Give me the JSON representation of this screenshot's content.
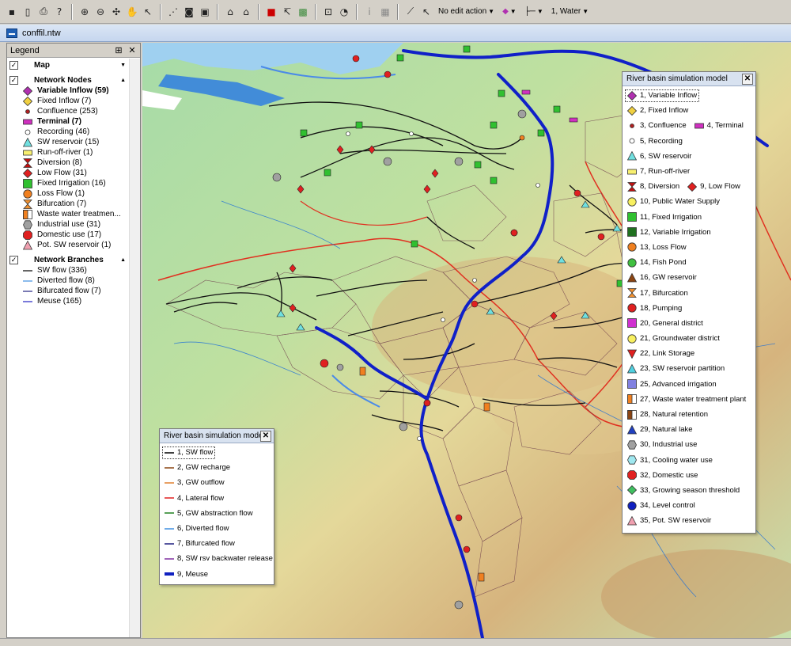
{
  "toolbar": {
    "edit_action": "No edit action",
    "layer": "1, Water",
    "buttons": [
      "save-icon",
      "new-icon",
      "print-icon",
      "help-icon",
      "zoom-in-icon",
      "zoom-out-icon",
      "zoom-extent-icon",
      "pan-icon",
      "select-icon",
      "node-tool-icon",
      "zoom-window-icon",
      "zoom-full-icon",
      "lock-icon",
      "unlock-icon",
      "flag-icon",
      "edit-node-icon",
      "map-icon",
      "screen-icon",
      "layers-icon",
      "info-icon",
      "window-icon",
      "branch-tool-icon",
      "pointer-icon"
    ]
  },
  "document": {
    "title": "conffil.ntw"
  },
  "legend": {
    "title": "Legend",
    "groups": [
      {
        "label": "Map",
        "checked": true,
        "items": []
      },
      {
        "label": "Network Nodes",
        "checked": true,
        "items": [
          {
            "label": "Variable Inflow (59)",
            "symbol": "diamond",
            "color": "#b030b0",
            "bold": true
          },
          {
            "label": "Fixed Inflow (7)",
            "symbol": "diamond",
            "color": "#f0d040"
          },
          {
            "label": "Confluence (253)",
            "symbol": "dot",
            "color": "#b02020"
          },
          {
            "label": "Terminal (7)",
            "symbol": "rect",
            "color": "#d030c0",
            "bold": true
          },
          {
            "label": "Recording (46)",
            "symbol": "circle-open",
            "color": "#ffffff"
          },
          {
            "label": "SW reservoir (15)",
            "symbol": "triangle",
            "color": "#70e0e0"
          },
          {
            "label": "Run-off-river (1)",
            "symbol": "rect",
            "color": "#f8f070"
          },
          {
            "label": "Diversion (8)",
            "symbol": "hourglass",
            "color": "#c01010"
          },
          {
            "label": "Low Flow (31)",
            "symbol": "diamond",
            "color": "#e02020"
          },
          {
            "label": "Fixed Irrigation (16)",
            "symbol": "square",
            "color": "#30c030"
          },
          {
            "label": "Loss Flow (1)",
            "symbol": "circle",
            "color": "#f08020"
          },
          {
            "label": "Bifurcation (7)",
            "symbol": "hourglass",
            "color": "#f09030"
          },
          {
            "label": "Waste water treatmen...",
            "symbol": "square-split",
            "color": "#f08020"
          },
          {
            "label": "Industrial use (31)",
            "symbol": "hexagon",
            "color": "#a0a0a0"
          },
          {
            "label": "Domestic use (17)",
            "symbol": "octagon",
            "color": "#e02020"
          },
          {
            "label": "Pot. SW reservoir (1)",
            "symbol": "triangle",
            "color": "#f0a0b0"
          }
        ]
      },
      {
        "label": "Network Branches",
        "checked": true,
        "items": [
          {
            "label": "SW flow (336)",
            "symbol": "line",
            "color": "#000000"
          },
          {
            "label": "Diverted flow (8)",
            "symbol": "line",
            "color": "#4090e0"
          },
          {
            "label": "Bifurcated flow (7)",
            "symbol": "line",
            "color": "#202080"
          },
          {
            "label": "Meuse (165)",
            "symbol": "line",
            "color": "#2020c0"
          }
        ]
      }
    ]
  },
  "branch_window": {
    "title": "River basin simulation mode",
    "items": [
      {
        "label": "1, SW flow",
        "color": "#000000",
        "width": 1.5,
        "selected": true
      },
      {
        "label": "2, GW recharge",
        "color": "#8b4513",
        "width": 1.5
      },
      {
        "label": "3, GW outflow",
        "color": "#e08030",
        "width": 1.5
      },
      {
        "label": "4, Lateral flow",
        "color": "#e02020",
        "width": 1.5
      },
      {
        "label": "5, GW abstraction flow",
        "color": "#208020",
        "width": 1.5
      },
      {
        "label": "6, Diverted flow",
        "color": "#4090e0",
        "width": 1.5
      },
      {
        "label": "7, Bifurcated flow",
        "color": "#202080",
        "width": 1.5
      },
      {
        "label": "8, SW rsv backwater release",
        "color": "#8030a0",
        "width": 1.5
      },
      {
        "label": "9, Meuse",
        "color": "#1020c0",
        "width": 4
      }
    ]
  },
  "nodes_window": {
    "title": "River basin simulation model",
    "rows": [
      [
        {
          "label": "1, Variable Inflow",
          "symbol": "diamond",
          "color": "#b030b0",
          "selected": true
        }
      ],
      [
        {
          "label": "2, Fixed Inflow",
          "symbol": "diamond",
          "color": "#f0d040"
        }
      ],
      [
        {
          "label": "3, Confluence",
          "symbol": "dot",
          "color": "#b02020"
        },
        {
          "label": "4, Terminal",
          "symbol": "rect",
          "color": "#d030c0"
        }
      ],
      [
        {
          "label": "5, Recording",
          "symbol": "circle-open",
          "color": "#ffffff"
        }
      ],
      [
        {
          "label": "6, SW reservoir",
          "symbol": "triangle",
          "color": "#70e0e0"
        }
      ],
      [
        {
          "label": "7, Run-off-river",
          "symbol": "rect",
          "color": "#f8f070"
        }
      ],
      [
        {
          "label": "8, Diversion",
          "symbol": "hourglass",
          "color": "#c01010"
        },
        {
          "label": "9, Low Flow",
          "symbol": "diamond",
          "color": "#e02020"
        }
      ],
      [
        {
          "label": "10, Public Water Supply",
          "symbol": "circle",
          "color": "#f8f060"
        }
      ],
      [
        {
          "label": "11, Fixed Irrigation",
          "symbol": "square",
          "color": "#30c030"
        }
      ],
      [
        {
          "label": "12, Variable Irrigation",
          "symbol": "square",
          "color": "#207020"
        }
      ],
      [
        {
          "label": "13, Loss Flow",
          "symbol": "circle",
          "color": "#f08020"
        }
      ],
      [
        {
          "label": "14, Fish Pond",
          "symbol": "circle",
          "color": "#40c040"
        }
      ],
      [
        {
          "label": "16, GW reservoir",
          "symbol": "triangle",
          "color": "#8b4513"
        }
      ],
      [
        {
          "label": "17, Bifurcation",
          "symbol": "hourglass",
          "color": "#f09030"
        }
      ],
      [
        {
          "label": "18, Pumping",
          "symbol": "circle",
          "color": "#e02020"
        }
      ],
      [
        {
          "label": "20, General district",
          "symbol": "square",
          "color": "#d030d0"
        }
      ],
      [
        {
          "label": "21, Groundwater district",
          "symbol": "circle",
          "color": "#f8f060"
        }
      ],
      [
        {
          "label": "22, Link Storage",
          "symbol": "triangle-down",
          "color": "#e02020"
        }
      ],
      [
        {
          "label": "23, SW reservoir partition",
          "symbol": "triangle",
          "color": "#50d0e0"
        }
      ],
      [
        {
          "label": "25, Advanced irrigation",
          "symbol": "square",
          "color": "#8080e0"
        }
      ],
      [
        {
          "label": "27, Waste water treatment plant",
          "symbol": "square-split",
          "color": "#f08020"
        }
      ],
      [
        {
          "label": "28, Natural retention",
          "symbol": "square-split",
          "color": "#8b4513"
        }
      ],
      [
        {
          "label": "29, Natural lake",
          "symbol": "triangle",
          "color": "#2040c0"
        }
      ],
      [
        {
          "label": "30, Industrial use",
          "symbol": "hexagon",
          "color": "#a0a0a0"
        }
      ],
      [
        {
          "label": "31, Cooling water use",
          "symbol": "hexagon",
          "color": "#a0e8f0"
        }
      ],
      [
        {
          "label": "32, Domestic use",
          "symbol": "octagon",
          "color": "#e02020"
        }
      ],
      [
        {
          "label": "33, Growing season threshold",
          "symbol": "diamond",
          "color": "#40c060"
        }
      ],
      [
        {
          "label": "34, Level control",
          "symbol": "circle",
          "color": "#1020c0"
        }
      ],
      [
        {
          "label": "35, Pot. SW reservoir",
          "symbol": "triangle",
          "color": "#f0a0b0"
        }
      ]
    ]
  }
}
